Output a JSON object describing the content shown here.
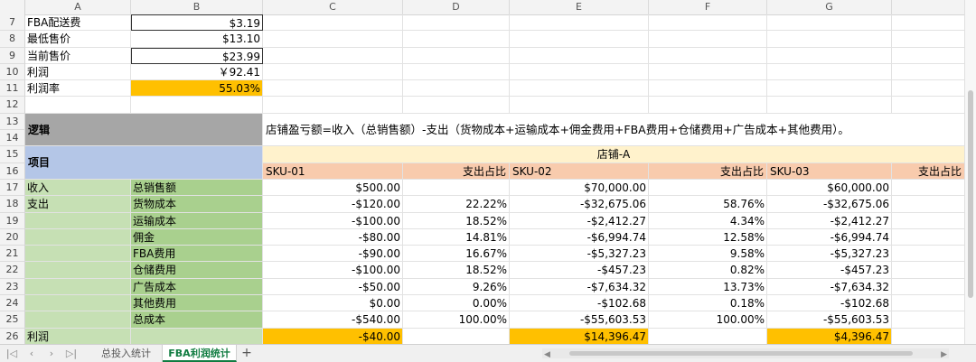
{
  "columns": [
    "A",
    "B",
    "C",
    "D",
    "E",
    "F",
    "G"
  ],
  "rows": {
    "r7": {
      "num": "7",
      "a": "FBA配送费",
      "b": "$3.19"
    },
    "r8": {
      "num": "8",
      "a": "最低售价",
      "b": "$13.10"
    },
    "r9": {
      "num": "9",
      "a": "当前售价",
      "b": "$23.99"
    },
    "r10": {
      "num": "10",
      "a": "利润",
      "b": "￥92.41"
    },
    "r11": {
      "num": "11",
      "a": "利润率",
      "b": "55.03%"
    },
    "r12": {
      "num": "12"
    },
    "r13": {
      "num": "13"
    },
    "r14": {
      "num": "14"
    },
    "r15": {
      "num": "15"
    },
    "r16": {
      "num": "16"
    }
  },
  "logic": {
    "label": "逻辑",
    "text": "店铺盈亏额=收入（总销售额）-支出（货物成本+运输成本+佣金费用+FBA费用+仓储费用+广告成本+其他费用）。"
  },
  "project": {
    "label": "项目"
  },
  "store": {
    "label": "店铺-A"
  },
  "sku_headers": {
    "sku1": "SKU-01",
    "ratio1": "支出占比",
    "sku2": "SKU-02",
    "ratio2": "支出占比",
    "sku3": "SKU-03",
    "ratio3": "支出占比"
  },
  "table": [
    {
      "num": "17",
      "a": "收入",
      "b": "总销售额",
      "c": "$500.00",
      "d": "",
      "e": "$70,000.00",
      "f": "",
      "g": "$60,000.00"
    },
    {
      "num": "18",
      "a": "支出",
      "b": "货物成本",
      "c": "-$120.00",
      "d": "22.22%",
      "e": "-$32,675.06",
      "f": "58.76%",
      "g": "-$32,675.06"
    },
    {
      "num": "19",
      "a": "",
      "b": "运输成本",
      "c": "-$100.00",
      "d": "18.52%",
      "e": "-$2,412.27",
      "f": "4.34%",
      "g": "-$2,412.27"
    },
    {
      "num": "20",
      "a": "",
      "b": "佣金",
      "c": "-$80.00",
      "d": "14.81%",
      "e": "-$6,994.74",
      "f": "12.58%",
      "g": "-$6,994.74"
    },
    {
      "num": "21",
      "a": "",
      "b": "FBA费用",
      "c": "-$90.00",
      "d": "16.67%",
      "e": "-$5,327.23",
      "f": "9.58%",
      "g": "-$5,327.23"
    },
    {
      "num": "22",
      "a": "",
      "b": "仓储费用",
      "c": "-$100.00",
      "d": "18.52%",
      "e": "-$457.23",
      "f": "0.82%",
      "g": "-$457.23"
    },
    {
      "num": "23",
      "a": "",
      "b": "广告成本",
      "c": "-$50.00",
      "d": "9.26%",
      "e": "-$7,634.32",
      "f": "13.73%",
      "g": "-$7,634.32"
    },
    {
      "num": "24",
      "a": "",
      "b": "其他费用",
      "c": "$0.00",
      "d": "0.00%",
      "e": "-$102.68",
      "f": "0.18%",
      "g": "-$102.68"
    },
    {
      "num": "25",
      "a": "",
      "b": "总成本",
      "c": "-$540.00",
      "d": "100.00%",
      "e": "-$55,603.53",
      "f": "100.00%",
      "g": "-$55,603.53"
    }
  ],
  "profit_row": {
    "num": "26",
    "a": "利润",
    "c": "-$40.00",
    "e": "$14,396.47",
    "g": "$4,396.47"
  },
  "tabs": [
    {
      "label": "总投入统计",
      "active": false
    },
    {
      "label": "FBA利润统计",
      "active": true
    }
  ],
  "add_tab": "+",
  "colors": {
    "yellow": "#ffc000",
    "gray": "#a6a6a6",
    "blue": "#b4c6e7",
    "light_green": "#c6e0b4",
    "green": "#a9d08e",
    "peach": "#f8cbad",
    "light_yellow": "#fff2cc",
    "active_tab": "#107c41"
  }
}
